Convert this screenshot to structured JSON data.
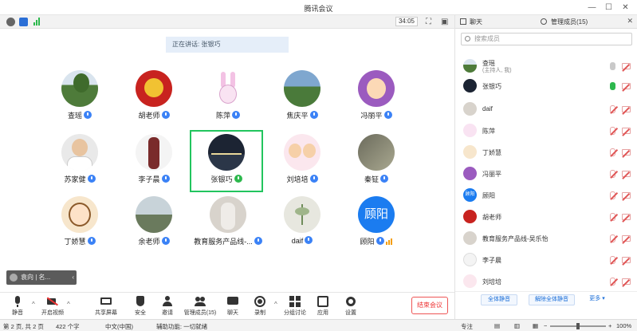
{
  "window": {
    "title": "腾讯会议"
  },
  "topbar": {
    "timer": "34:05"
  },
  "stage": {
    "speaking_label": "正在讲话:",
    "speaking_name": "张银巧",
    "participants": [
      {
        "name": "查瑶"
      },
      {
        "name": "胡老师"
      },
      {
        "name": "陈萍"
      },
      {
        "name": "焦庆平"
      },
      {
        "name": "冯丽平"
      },
      {
        "name": "苏家健"
      },
      {
        "name": "李子晨"
      },
      {
        "name": "张银巧"
      },
      {
        "name": "刘培培"
      },
      {
        "name": "秦钲"
      },
      {
        "name": "丁娇慧"
      },
      {
        "name": "余老师"
      },
      {
        "name": "教育服务产品线-..."
      },
      {
        "name": "daif"
      },
      {
        "name": "顾阳",
        "avatar_text": "顾阳"
      }
    ],
    "hand_label": "袁向 | 名..."
  },
  "bottombar": {
    "tools": [
      {
        "label": "静音",
        "icon": "mic-icon"
      },
      {
        "label": "开启视频",
        "icon": "camera-off-icon"
      },
      {
        "label": "共享屏幕",
        "icon": "share-screen-icon"
      },
      {
        "label": "安全",
        "icon": "shield-icon"
      },
      {
        "label": "邀请",
        "icon": "invite-icon"
      },
      {
        "label": "管理成员(15)",
        "icon": "members-icon"
      },
      {
        "label": "聊天",
        "icon": "chat-icon"
      },
      {
        "label": "录制",
        "icon": "record-icon"
      },
      {
        "label": "分组讨论",
        "icon": "breakout-icon"
      },
      {
        "label": "应用",
        "icon": "apps-icon"
      },
      {
        "label": "设置",
        "icon": "gear-icon"
      }
    ],
    "end_label": "结束会议"
  },
  "panel": {
    "tab_chat": "聊天",
    "tab_members": "管理成员(15)",
    "search_placeholder": "搜索成员",
    "members": [
      {
        "name": "查瑶",
        "sub": "(主持人, 我)"
      },
      {
        "name": "张银巧"
      },
      {
        "name": "daif"
      },
      {
        "name": "陈萍"
      },
      {
        "name": "丁娇慧"
      },
      {
        "name": "冯丽平"
      },
      {
        "name": "顾阳",
        "avatar_text": "顾阳"
      },
      {
        "name": "胡老师"
      },
      {
        "name": "教育服务产品线-吴乐怡"
      },
      {
        "name": "李子晨"
      },
      {
        "name": "刘培培"
      }
    ],
    "mute_all": "全体静音",
    "unmute_all": "解除全体静音",
    "more": "更多 ▾"
  },
  "statusbar": {
    "pages": "第 2 页, 共 2 页",
    "words": "422 个字",
    "lang": "中文(中国)",
    "accessibility": "辅助功能: 一切就绪",
    "focus": "专注",
    "zoom": "100%"
  },
  "colors": {
    "accent": "#1a6ed8",
    "active": "#22c55e",
    "danger": "#e33333"
  }
}
